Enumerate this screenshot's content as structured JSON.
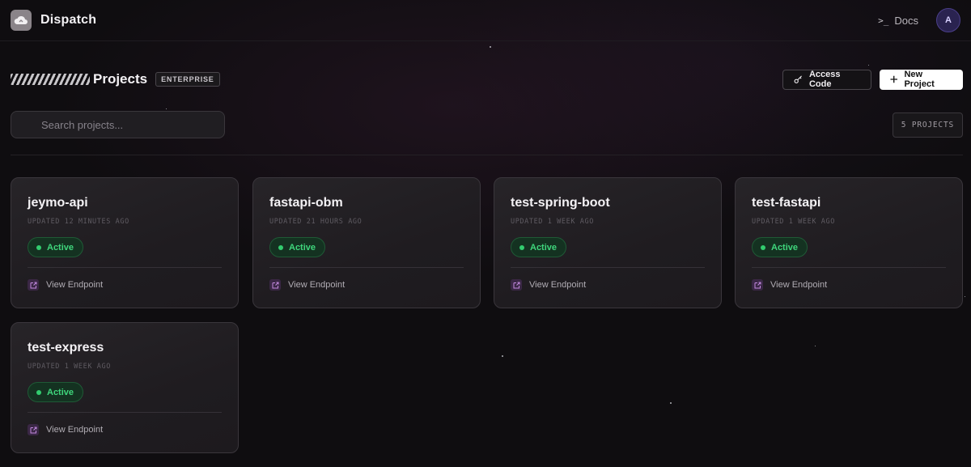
{
  "app": {
    "brand_name": "Dispatch",
    "nav": {
      "docs_label": "Docs",
      "avatar_initial": "A"
    }
  },
  "header": {
    "title_suffix": "Projects",
    "plan_badge": "ENTERPRISE",
    "access_code_label": "Access Code",
    "new_project_label": "New Project"
  },
  "search": {
    "placeholder": "Search projects...",
    "value": ""
  },
  "project_count": "5 PROJECTS",
  "projects": [
    {
      "name": "jeymo-api",
      "updated": "UPDATED 12 MINUTES AGO",
      "status": "Active",
      "endpoint_label": "View Endpoint"
    },
    {
      "name": "fastapi-obm",
      "updated": "UPDATED 21 HOURS AGO",
      "status": "Active",
      "endpoint_label": "View Endpoint"
    },
    {
      "name": "test-spring-boot",
      "updated": "UPDATED 1 WEEK AGO",
      "status": "Active",
      "endpoint_label": "View Endpoint"
    },
    {
      "name": "test-fastapi",
      "updated": "UPDATED 1 WEEK AGO",
      "status": "Active",
      "endpoint_label": "View Endpoint"
    },
    {
      "name": "test-express",
      "updated": "UPDATED 1 WEEK AGO",
      "status": "Active",
      "endpoint_label": "View Endpoint"
    }
  ],
  "colors": {
    "background": "#0f0d10",
    "card_border": "#3a363c",
    "status_green": "#3fd67c",
    "avatar_purple": "#2a2350",
    "endpoint_icon": "#3a2745"
  },
  "icons": {
    "logo": "cloud-logo-icon",
    "docs": "terminal-icon",
    "access_code": "key-icon",
    "new_project": "plus-icon",
    "search": "search-icon",
    "endpoint": "external-link-icon"
  }
}
